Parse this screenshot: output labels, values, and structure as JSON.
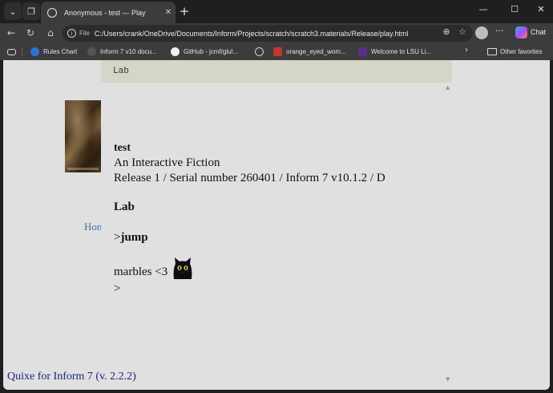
{
  "browser": {
    "tab_title": "Anonymous - test — Play",
    "tab_close": "✕",
    "new_tab": "+",
    "window_controls": {
      "minimize": "—",
      "maximize": "☐",
      "close": "✕"
    },
    "address": {
      "scheme_label": "File",
      "url": "C:/Users/crank/OneDrive/Documents/Inform/Projects/scratch/scratch3.materials/Release/play.html"
    },
    "chat_label": "Chat",
    "favorites": [
      {
        "label": "Rules Chart",
        "icon": "wordpress-icon",
        "color": "#2f6fd6"
      },
      {
        "label": "Inform 7 v10 docu...",
        "icon": "globe-dark-icon",
        "color": "#555555"
      },
      {
        "label": "GitHub - jcmf/glul...",
        "icon": "github-icon",
        "color": "#f0f0f0"
      },
      {
        "label": "",
        "icon": "globe-icon",
        "color": "#d0d0d0"
      },
      {
        "label": "orange_eyed_wom...",
        "icon": "image-icon",
        "color": "#c0392b"
      },
      {
        "label": "Welcome to LSU Li...",
        "icon": "lsu-icon",
        "color": "#5b2d8e"
      }
    ],
    "more_favorites": "›",
    "other_favorites": "Other favorites"
  },
  "game": {
    "status_location": "Lab",
    "story_title": "test",
    "story_subtitle": "An Interactive Fiction",
    "release_line": "Release 1 / Serial number 260401 / Inform 7 v10.1.2 / D",
    "room_name": "Lab",
    "prompt_symbol": ">",
    "command": "jump",
    "response": "marbles <3",
    "input_prompt": ">",
    "home_link": "Home",
    "footer": "Quixe for Inform 7 (v. 2.2.2)"
  }
}
